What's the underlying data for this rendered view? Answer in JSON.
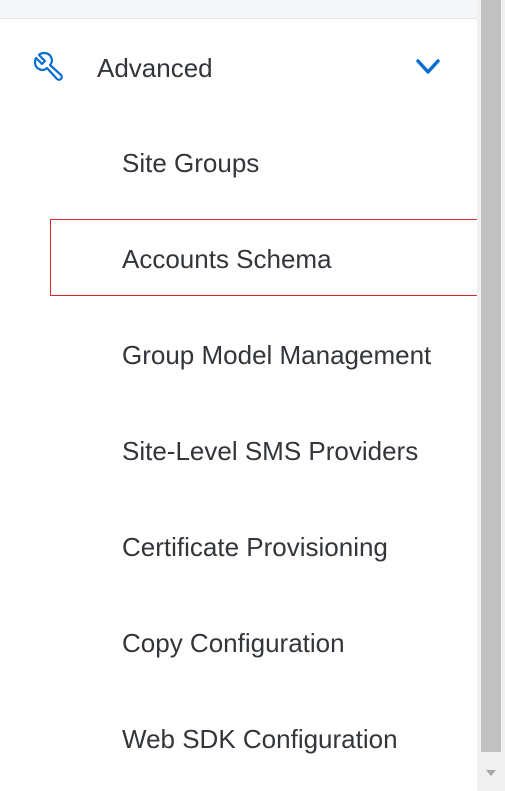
{
  "section": {
    "label": "Advanced",
    "icon": "wrench-icon",
    "expanded": true
  },
  "items": [
    {
      "label": "Site Groups"
    },
    {
      "label": "Accounts Schema",
      "highlighted": true
    },
    {
      "label": "Group Model Management"
    },
    {
      "label": "Site-Level SMS Providers"
    },
    {
      "label": "Certificate Provisioning"
    },
    {
      "label": "Copy Configuration"
    },
    {
      "label": "Web SDK Configuration"
    }
  ],
  "colors": {
    "accent": "#0a6ed1",
    "text": "#32363a",
    "highlight_border": "#d9252c"
  }
}
